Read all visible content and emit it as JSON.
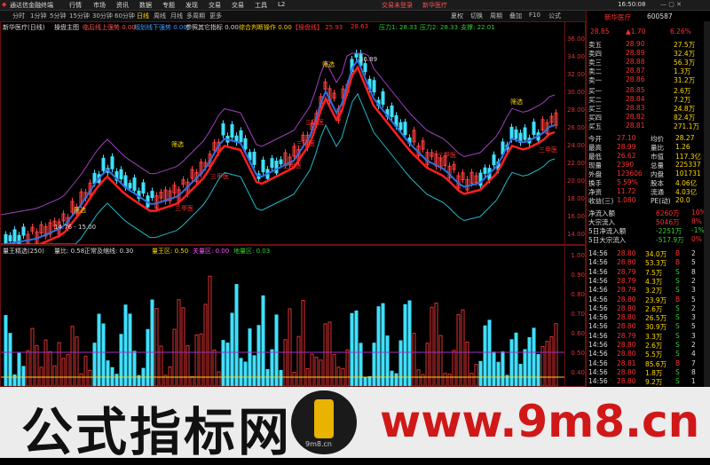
{
  "titlebar": {
    "app_name": "通达信金融终端",
    "menus": [
      "行情",
      "市场",
      "资讯",
      "数据",
      "专题",
      "发现",
      "交易",
      "交易",
      "工具",
      "L2"
    ],
    "center": "交易未登录",
    "center2": "新华医疗",
    "right_items": [
      "夏权",
      "切换",
      "周期",
      "叠加",
      "F10",
      "公式"
    ],
    "clock": "16:50:08"
  },
  "tabs": [
    "分时",
    "1分钟",
    "5分钟",
    "15分钟",
    "30分钟",
    "60分钟",
    "日线",
    "周线",
    "月线",
    "多周期",
    "更多"
  ],
  "active_tab": "日线",
  "legend_main": {
    "stock": "新华医疗(日线)",
    "indicator": "操盘主图",
    "items": [
      "临后线上强势 0.00",
      "规划线下强势 0.00",
      "参照其它指标 0.00",
      "综合判断操作 0.00",
      "【操盘线】 25.93",
      "28.63",
      "压力1: 28.33",
      "压力2: 28.33",
      "支撑: 22.01"
    ]
  },
  "price_axis": [
    "36.00",
    "34.00",
    "32.00",
    "30.00",
    "28.00",
    "26.00",
    "24.00",
    "22.00",
    "20.00",
    "18.00",
    "16.00",
    "14.00"
  ],
  "chart_annotations": {
    "high": "36.89",
    "low_range": "14.76 - 15.00",
    "labels": [
      "三甲医",
      "三甲医",
      "三甲医",
      "三甲医",
      "三甲医",
      "三甲医",
      "三甲医",
      "筛选",
      "筛选",
      "筛选",
      "筛选"
    ]
  },
  "legend_ind": {
    "name": "量王精选(250)",
    "items": [
      "量比: 0.58",
      "正常及缩线: 0.30",
      "量王区: 0.50",
      "关量区: 0.00",
      "地量区: 0.03"
    ]
  },
  "vol_axis": [
    "1.00",
    "0.90",
    "0.80",
    "0.70",
    "0.60",
    "0.50",
    "0.40"
  ],
  "quote": {
    "name": "新华医疗",
    "code": "600587",
    "price": "28.85",
    "change": "▲1.70",
    "pct": "6.26%",
    "asks": [
      {
        "label": "卖五",
        "price": "28.90",
        "vol": "27.5万"
      },
      {
        "label": "卖四",
        "price": "28.89",
        "vol": "32.4万"
      },
      {
        "label": "卖三",
        "price": "28.88",
        "vol": "56.3万"
      },
      {
        "label": "卖二",
        "price": "28.87",
        "vol": "1.3万"
      },
      {
        "label": "卖一",
        "price": "28.86",
        "vol": "31.2万"
      }
    ],
    "bids": [
      {
        "label": "买一",
        "price": "28.85",
        "vol": "2.6万"
      },
      {
        "label": "买二",
        "price": "28.84",
        "vol": "7.2万"
      },
      {
        "label": "买三",
        "price": "28.83",
        "vol": "24.8万"
      },
      {
        "label": "买四",
        "price": "28.82",
        "vol": "82.4万"
      },
      {
        "label": "买五",
        "price": "28.81",
        "vol": "271.1万"
      }
    ],
    "stats": [
      [
        "今开",
        "27.10",
        "均价",
        "28.27"
      ],
      [
        "最高",
        "28.99",
        "量比",
        "1.26"
      ],
      [
        "最低",
        "26.62",
        "市值",
        "117.3亿"
      ],
      [
        "现量",
        "2390",
        "总量",
        "225337"
      ],
      [
        "外盘",
        "123606",
        "内盘",
        "101731"
      ],
      [
        "换手",
        "5.59%",
        "股本",
        "4.06亿"
      ],
      [
        "净资",
        "11.72",
        "流通",
        "4.03亿"
      ],
      [
        "收益(三)",
        "1.080",
        "PE(动)",
        "20.0"
      ]
    ],
    "flows": [
      [
        "净流入额",
        "6260万",
        "10%"
      ],
      [
        "大宗流入",
        "5046万",
        "8%"
      ],
      [
        "5日净流入额",
        "-2251万",
        "-1%"
      ],
      [
        "5日大宗流入",
        "-517.9万",
        "0%"
      ]
    ],
    "ticks": [
      [
        "14:56",
        "28.80",
        "34.0万",
        "B",
        "2"
      ],
      [
        "14:56",
        "28.80",
        "53.3万",
        "B",
        "5"
      ],
      [
        "14:56",
        "28.79",
        "7.5万",
        "S",
        "8"
      ],
      [
        "14:56",
        "28.79",
        "4.3万",
        "S",
        "2"
      ],
      [
        "14:56",
        "28.79",
        "3.2万",
        "S",
        "3"
      ],
      [
        "14:56",
        "28.80",
        "23.9万",
        "B",
        "5"
      ],
      [
        "14:56",
        "28.80",
        "2.6万",
        "S",
        "2"
      ],
      [
        "14:56",
        "28.80",
        "26.5万",
        "S",
        "3"
      ],
      [
        "14:56",
        "28.80",
        "30.9万",
        "S",
        "5"
      ],
      [
        "14:56",
        "28.79",
        "3.3万",
        "S",
        "3"
      ],
      [
        "14:56",
        "28.80",
        "2.6万",
        "S",
        "2"
      ],
      [
        "14:56",
        "28.80",
        "5.5万",
        "S",
        "4"
      ],
      [
        "14:56",
        "28.81",
        "85.6万",
        "B",
        "7"
      ],
      [
        "14:56",
        "28.80",
        "1.8万",
        "S",
        "8"
      ],
      [
        "14:56",
        "28.80",
        "9.2万",
        "S",
        "1"
      ]
    ]
  },
  "banner": {
    "left_text": "公式指标网",
    "right_text": "www.9m8.cn",
    "logo_text": "9m8.cn"
  }
}
